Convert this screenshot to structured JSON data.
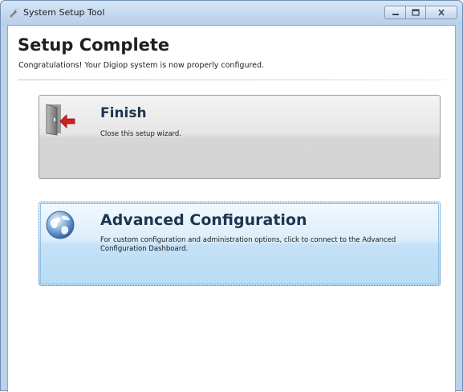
{
  "window": {
    "title": "System Setup Tool"
  },
  "header": {
    "title": "Setup Complete",
    "subtitle": "Congratulations! Your Digiop system is now properly configured."
  },
  "commands": {
    "finish": {
      "title": "Finish",
      "description": "Close this setup wizard.",
      "icon": "exit-door-icon"
    },
    "advanced": {
      "title": "Advanced Configuration",
      "description": "For custom configuration and administration options, click to connect to the Advanced Configuration Dashboard.",
      "icon": "globe-icon",
      "state": "focused"
    }
  },
  "colors": {
    "titlebar": "#c3d8ee",
    "highlight": "#c4e1f7",
    "finish_arrow": "#d22020"
  }
}
